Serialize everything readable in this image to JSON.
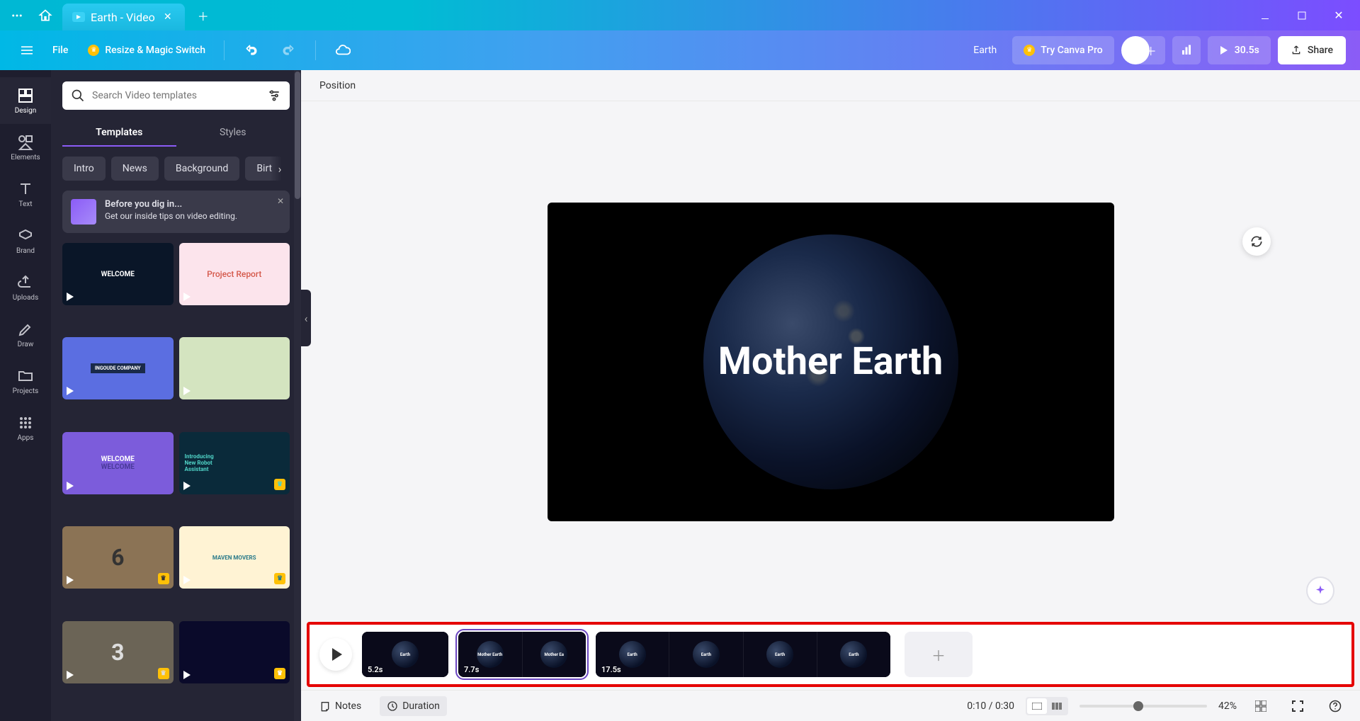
{
  "titlebar": {
    "tab_title": "Earth - Video"
  },
  "toolbar": {
    "file": "File",
    "resize": "Resize & Magic Switch",
    "doc_title": "Earth",
    "try_pro": "Try Canva Pro",
    "duration": "30.5s",
    "share": "Share"
  },
  "leftnav": {
    "design": "Design",
    "elements": "Elements",
    "text": "Text",
    "brand": "Brand",
    "uploads": "Uploads",
    "draw": "Draw",
    "projects": "Projects",
    "apps": "Apps"
  },
  "sidepanel": {
    "search_placeholder": "Search Video templates",
    "tab_templates": "Templates",
    "tab_styles": "Styles",
    "chips": {
      "intro": "Intro",
      "news": "News",
      "background": "Background",
      "birthday": "Birt"
    },
    "tip_title": "Before you dig in...",
    "tip_body": "Get our inside tips on video editing.",
    "templates": {
      "t1": "WELCOME",
      "t2": "Project Report",
      "t3": "INGOUDE COMPANY",
      "t5a": "WELCOME",
      "t5b": "WELCOME",
      "t6a": "Introducing",
      "t6b": "New Robot",
      "t6c": "Assistant",
      "t7": "6",
      "t8": "MAVEN MOVERS",
      "t9": "3"
    }
  },
  "context": {
    "position": "Position"
  },
  "canvas": {
    "heading": "Mother Earth"
  },
  "timeline": {
    "clip1": {
      "label": "Earth",
      "duration": "5.2s"
    },
    "clip2": {
      "label1": "Mother Earth",
      "label2": "Mother Ea",
      "duration": "7.7s"
    },
    "clip3": {
      "label": "Earth",
      "duration": "17.5s"
    }
  },
  "bottombar": {
    "notes": "Notes",
    "duration": "Duration",
    "timecode": "0:10 / 0:30",
    "zoom_pct": "42%"
  }
}
